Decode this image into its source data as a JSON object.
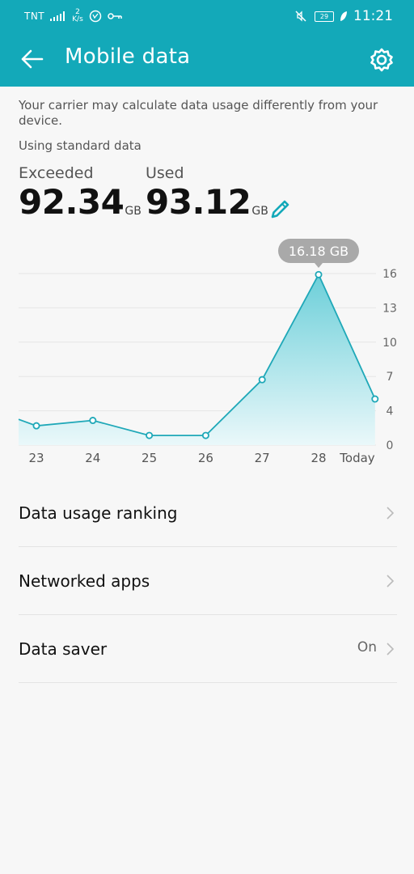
{
  "status_bar": {
    "carrier": "TNT",
    "speed_value": "2",
    "speed_unit": "K/s",
    "battery": "29",
    "time": "11:21"
  },
  "app_bar": {
    "title": "Mobile data",
    "back_icon": "arrow-left-icon",
    "settings_icon": "gear-icon"
  },
  "info": {
    "carrier_note": "Your carrier may calculate data usage differently from your device.",
    "standard_data": "Using standard data"
  },
  "stats": {
    "exceeded_label": "Exceeded",
    "exceeded_value": "92.34",
    "exceeded_unit": "GB",
    "used_label": "Used",
    "used_value": "93.12",
    "used_unit": "GB"
  },
  "chart_data": {
    "type": "area",
    "categories": [
      "23",
      "24",
      "25",
      "26",
      "27",
      "28",
      "Today"
    ],
    "values": [
      1.8,
      2.3,
      0.9,
      0.9,
      6.1,
      15.9,
      4.3
    ],
    "left_edge_value": 2.4,
    "callout": "16.18 GB",
    "callout_index": 5,
    "y_ticks": [
      "16",
      "13",
      "10",
      "7",
      "4",
      "0"
    ],
    "ylim": [
      0,
      16
    ],
    "grid": true,
    "colors": {
      "line": "#1fa8b8",
      "fill_top": "#6ccfd9",
      "fill_bottom": "#eaf8fa",
      "callout_bg": "#a9a9a9"
    }
  },
  "menu": {
    "items": [
      {
        "label": "Data usage ranking",
        "value": ""
      },
      {
        "label": "Networked apps",
        "value": ""
      },
      {
        "label": "Data saver",
        "value": "On"
      }
    ]
  },
  "colors": {
    "accent": "#13a9b9"
  }
}
